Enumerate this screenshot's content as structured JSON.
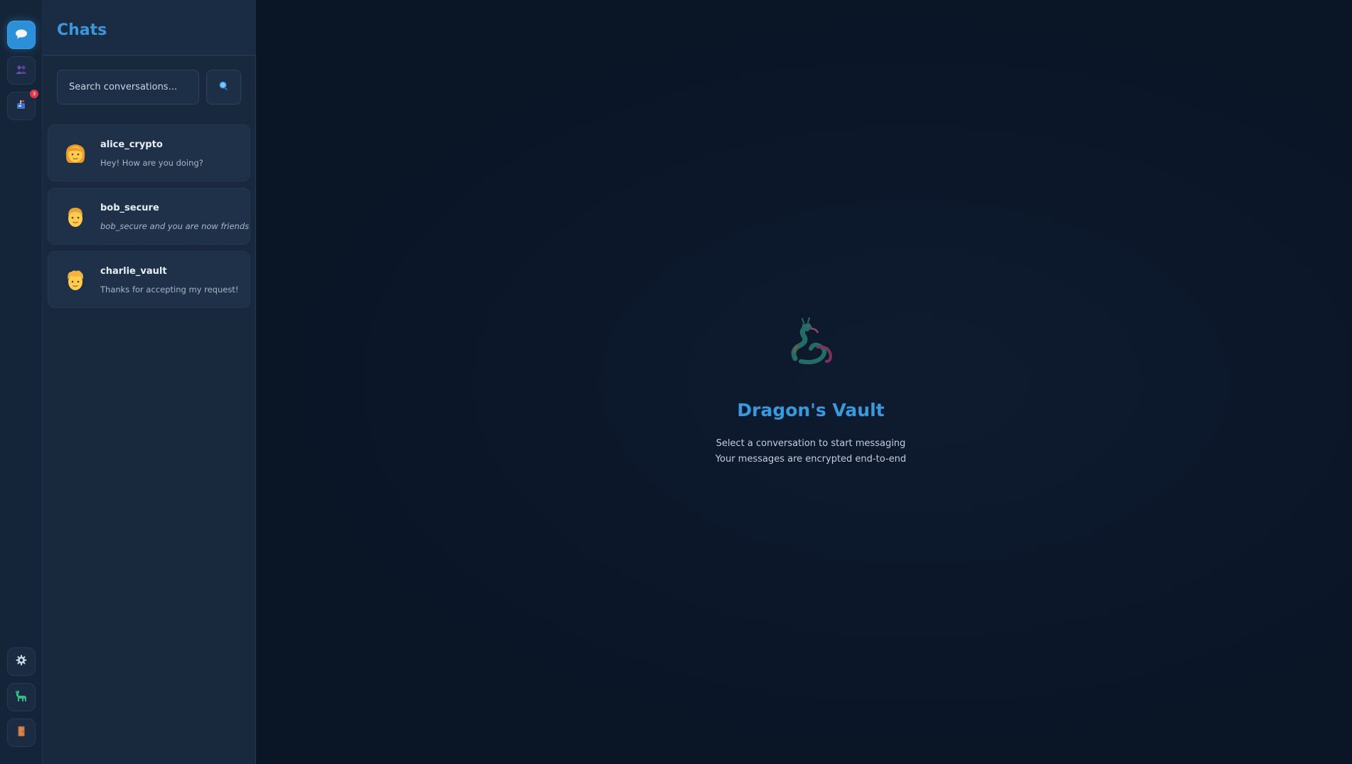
{
  "rail": {
    "top_items": [
      {
        "name": "chats-nav-button",
        "icon": "speech-bubble-icon",
        "active": true
      },
      {
        "name": "friends-nav-button",
        "icon": "people-icon",
        "active": false
      },
      {
        "name": "requests-nav-button",
        "icon": "mailbox-icon",
        "active": false,
        "badge": "3"
      }
    ],
    "bottom_items": [
      {
        "name": "settings-nav-button",
        "icon": "gear-icon"
      },
      {
        "name": "profile-nav-button",
        "icon": "dinosaur-icon"
      },
      {
        "name": "logout-nav-button",
        "icon": "door-icon"
      }
    ],
    "badge_count": "3"
  },
  "panel": {
    "title": "Chats",
    "search": {
      "placeholder": "Search conversations...",
      "value": "",
      "button_icon": "magnifier-icon"
    },
    "chats": [
      {
        "name": "alice_crypto",
        "preview": "Hey! How are you doing?",
        "italic": false,
        "avatar_icon": "woman-avatar-icon"
      },
      {
        "name": "bob_secure",
        "preview": "bob_secure and you are now friends",
        "italic": true,
        "avatar_icon": "man-avatar-icon"
      },
      {
        "name": "charlie_vault",
        "preview": "Thanks for accepting my request!",
        "italic": false,
        "avatar_icon": "person-avatar-icon"
      }
    ]
  },
  "main": {
    "empty_icon": "dragon-icon",
    "title": "Dragon's Vault",
    "line1": "Select a conversation to start messaging",
    "line2": "Your messages are encrypted end-to-end"
  },
  "colors": {
    "accent": "#3a98dd",
    "active_nav": "#2d8fd8",
    "badge": "#e0354a",
    "background": "#0b1628"
  }
}
